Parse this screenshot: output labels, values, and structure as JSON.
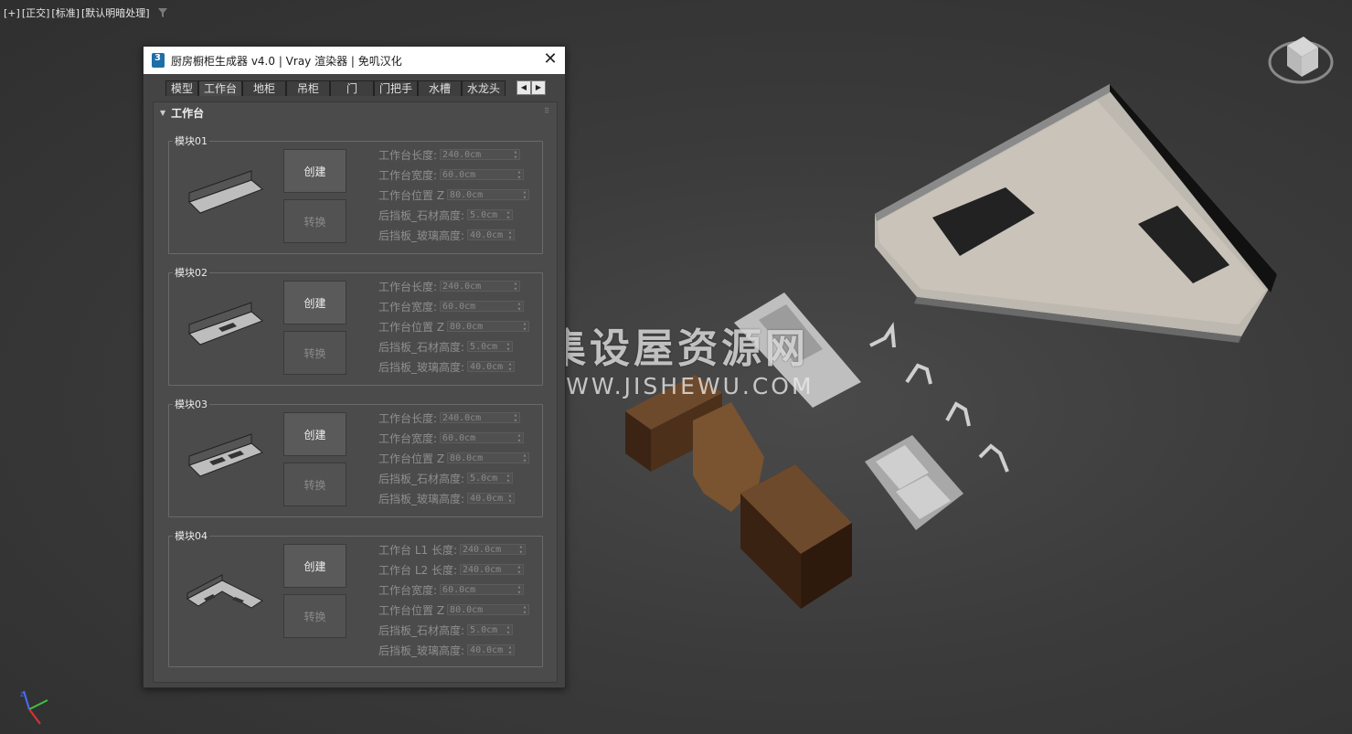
{
  "viewport": {
    "labels": [
      "[+]",
      "[正交]",
      "[标准]",
      "[默认明暗处理]"
    ],
    "filter_icon": "filter-icon",
    "viewcube_icon": "viewcube-icon",
    "axis_icon": "axis-gizmo-icon",
    "watermark": {
      "cn": "集设屋资源网",
      "en": "WWW.JISHEWU.COM"
    }
  },
  "dialog": {
    "title": "厨房橱柜生成器 v4.0 | Vray 渲染器 | 免叽汉化",
    "close_icon": "close-icon",
    "app_icon": "3dsmax-icon",
    "tabs": [
      "模型",
      "工作台",
      "地柜",
      "吊柜",
      "门",
      "门把手",
      "水槽",
      "水龙头"
    ],
    "active_tab": 1,
    "tab_arrows": [
      "◀",
      "▶"
    ],
    "rollout_title": "工作台",
    "modules": [
      {
        "title": "模块01",
        "create": "创建",
        "convert": "转换",
        "params": [
          {
            "label": "工作台长度:",
            "value": "240.0cm"
          },
          {
            "label": "工作台宽度:",
            "value": "60.0cm"
          },
          {
            "label": "工作台位置 Z",
            "value": "80.0cm"
          },
          {
            "label": "后挡板_石材高度:",
            "value": "5.0cm"
          },
          {
            "label": "后挡板_玻璃高度:",
            "value": "40.0cm"
          }
        ]
      },
      {
        "title": "模块02",
        "create": "创建",
        "convert": "转换",
        "params": [
          {
            "label": "工作台长度:",
            "value": "240.0cm"
          },
          {
            "label": "工作台宽度:",
            "value": "60.0cm"
          },
          {
            "label": "工作台位置 Z",
            "value": "80.0cm"
          },
          {
            "label": "后挡板_石材高度:",
            "value": "5.0cm"
          },
          {
            "label": "后挡板_玻璃高度:",
            "value": "40.0cm"
          }
        ]
      },
      {
        "title": "模块03",
        "create": "创建",
        "convert": "转换",
        "params": [
          {
            "label": "工作台长度:",
            "value": "240.0cm"
          },
          {
            "label": "工作台宽度:",
            "value": "60.0cm"
          },
          {
            "label": "工作台位置 Z",
            "value": "80.0cm"
          },
          {
            "label": "后挡板_石材高度:",
            "value": "5.0cm"
          },
          {
            "label": "后挡板_玻璃高度:",
            "value": "40.0cm"
          }
        ]
      },
      {
        "title": "模块04",
        "create": "创建",
        "convert": "转换",
        "params": [
          {
            "label": "工作台 L1 长度:",
            "value": "240.0cm"
          },
          {
            "label": "工作台 L2 长度:",
            "value": "240.0cm"
          },
          {
            "label": "工作台宽度:",
            "value": "60.0cm"
          },
          {
            "label": "工作台位置 Z",
            "value": "80.0cm"
          },
          {
            "label": "后挡板_石材高度:",
            "value": "5.0cm"
          },
          {
            "label": "后挡板_玻璃高度:",
            "value": "40.0cm"
          }
        ]
      }
    ]
  }
}
